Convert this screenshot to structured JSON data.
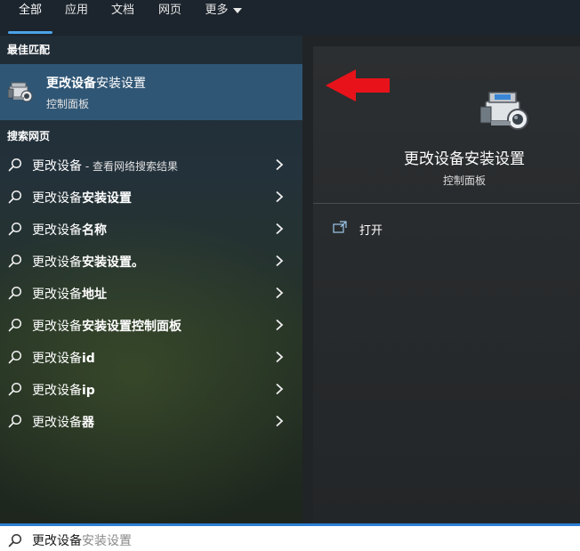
{
  "tabs": [
    {
      "label": "全部",
      "active": true
    },
    {
      "label": "应用",
      "active": false
    },
    {
      "label": "文档",
      "active": false
    },
    {
      "label": "网页",
      "active": false
    },
    {
      "label": "更多",
      "active": false
    }
  ],
  "best_match": {
    "section_label": "最佳匹配",
    "title_bold": "更改设备",
    "title_rest": "安装设置",
    "subtitle": "控制面板",
    "icon": "device-installation-settings-icon"
  },
  "web_search": {
    "section_label": "搜索网页",
    "items": [
      {
        "bold": "更改设备",
        "rest": "",
        "muted": " - 查看网络搜索结果"
      },
      {
        "bold": "更改设备",
        "rest": "安装设置",
        "muted": ""
      },
      {
        "bold": "更改设备",
        "rest": "名称",
        "muted": ""
      },
      {
        "bold": "更改设备",
        "rest": "安装设置。",
        "muted": ""
      },
      {
        "bold": "更改设备",
        "rest": "地址",
        "muted": ""
      },
      {
        "bold": "更改设备",
        "rest": "安装设置控制面板",
        "muted": ""
      },
      {
        "bold": "更改设备",
        "rest": "id",
        "muted": ""
      },
      {
        "bold": "更改设备",
        "rest": "ip",
        "muted": ""
      },
      {
        "bold": "更改设备",
        "rest": "器",
        "muted": ""
      }
    ]
  },
  "detail": {
    "title": "更改设备安装设置",
    "subtitle": "控制面板",
    "open_label": "打开"
  },
  "search": {
    "typed": "更改设备",
    "suggestion": "安装设置"
  },
  "colors": {
    "accent": "#4ba3e8",
    "selected_bg": "#2f5675",
    "arrow": "#e8131a"
  }
}
